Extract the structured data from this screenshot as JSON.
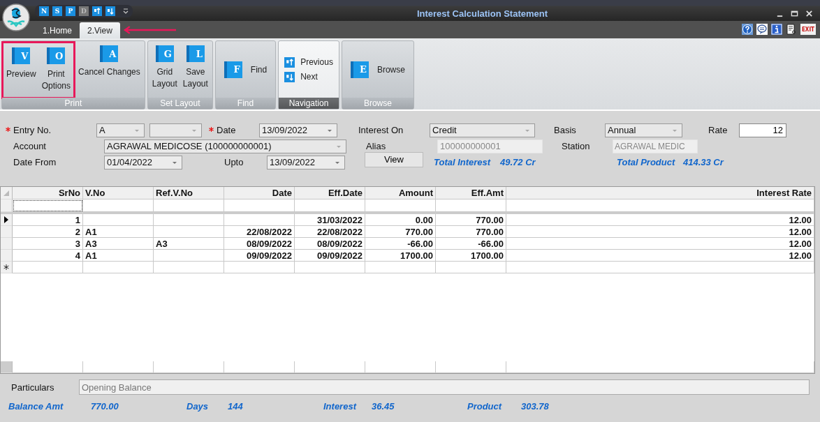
{
  "window": {
    "title": "Interest Calculation Statement",
    "exit_icon_text": "EXIT"
  },
  "quick_access": [
    {
      "kind": "letter",
      "glyph": "N",
      "disabled": false
    },
    {
      "kind": "letter",
      "glyph": "S",
      "disabled": false
    },
    {
      "kind": "letter",
      "glyph": "P",
      "disabled": false
    },
    {
      "kind": "letter",
      "glyph": "D",
      "disabled": true
    },
    {
      "kind": "up",
      "disabled": false
    },
    {
      "kind": "down",
      "disabled": false
    }
  ],
  "tabs": [
    {
      "label": "1.Home",
      "selected": false,
      "pointed": false
    },
    {
      "label": "2.View",
      "selected": true,
      "pointed": true
    }
  ],
  "ribbon": [
    {
      "label": "Print",
      "active": false,
      "buttons": [
        {
          "lines": [
            "Preview"
          ],
          "kind": "large",
          "glyph": "V",
          "highlighted": true
        },
        {
          "lines": [
            "Print",
            "Options"
          ],
          "kind": "large",
          "glyph": "O",
          "highlighted": true
        },
        {
          "lines": [
            "Cancel Changes"
          ],
          "kind": "large",
          "glyph": "A",
          "highlighted": false
        }
      ]
    },
    {
      "label": "Set Layout",
      "active": false,
      "buttons": [
        {
          "lines": [
            "Grid",
            "Layout"
          ],
          "kind": "large",
          "glyph": "G",
          "highlighted": false
        },
        {
          "lines": [
            "Save",
            "Layout"
          ],
          "kind": "large",
          "glyph": "L",
          "highlighted": false
        }
      ]
    },
    {
      "label": "Find",
      "active": false,
      "buttons": [
        {
          "lines": [
            "Find"
          ],
          "kind": "side",
          "glyph": "F",
          "highlighted": false
        }
      ]
    },
    {
      "label": "Navigation",
      "active": true,
      "buttons": [
        {
          "lines": [
            "Previous"
          ],
          "kind": "up",
          "highlighted": false
        },
        {
          "lines": [
            "Next"
          ],
          "kind": "down",
          "highlighted": false
        }
      ]
    },
    {
      "label": "Browse",
      "active": false,
      "buttons": [
        {
          "lines": [
            "Browse"
          ],
          "kind": "side",
          "glyph": "E",
          "highlighted": false
        }
      ]
    }
  ],
  "form": {
    "entry_no": {
      "label": "Entry No.",
      "required": true,
      "value": "A"
    },
    "date": {
      "label": "Date",
      "required": true,
      "value": "13/09/2022"
    },
    "interest_on": {
      "label": "Interest On",
      "value": "Credit"
    },
    "basis": {
      "label": "Basis",
      "value": "Annual"
    },
    "rate": {
      "label": "Rate",
      "value": "12"
    },
    "account": {
      "label": "Account",
      "value": "AGRAWAL MEDICOSE (100000000001)"
    },
    "alias": {
      "label": "Alias",
      "value": "100000000001",
      "disabled": true
    },
    "station": {
      "label": "Station",
      "value": "AGRAWAL MEDIC",
      "disabled": true
    },
    "date_from": {
      "label": "Date From",
      "value": "01/04/2022"
    },
    "upto": {
      "label": "Upto",
      "value": "13/09/2022"
    },
    "view_button": "View",
    "totals": [
      {
        "label": "Total Interest",
        "value": "49.72 Cr"
      },
      {
        "label": "Total Product",
        "value": "414.33 Cr"
      }
    ]
  },
  "table": {
    "columns": [
      "SrNo",
      "V.No",
      "Ref.V.No",
      "Date",
      "Eff.Date",
      "Amount",
      "Eff.Amt",
      "Interest Rate"
    ],
    "rows": [
      {
        "current": true,
        "cells": [
          "1",
          "",
          "",
          "",
          "31/03/2022",
          "0.00",
          "770.00",
          "12.00"
        ]
      },
      {
        "current": false,
        "cells": [
          "2",
          "A1",
          "",
          "22/08/2022",
          "22/08/2022",
          "770.00",
          "770.00",
          "12.00"
        ]
      },
      {
        "current": false,
        "cells": [
          "3",
          "A3",
          "A3",
          "08/09/2022",
          "08/09/2022",
          "-66.00",
          "-66.00",
          "12.00"
        ]
      },
      {
        "current": false,
        "cells": [
          "4",
          "A1",
          "",
          "09/09/2022",
          "09/09/2022",
          "1700.00",
          "1700.00",
          "12.00"
        ]
      }
    ]
  },
  "particulars": {
    "label": "Particulars",
    "value": "Opening Balance"
  },
  "summary": [
    {
      "label": "Balance Amt",
      "value": "770.00"
    },
    {
      "label": "Days",
      "value": "144"
    },
    {
      "label": "Interest",
      "value": "36.45"
    },
    {
      "label": "Product",
      "value": "303.78"
    }
  ]
}
